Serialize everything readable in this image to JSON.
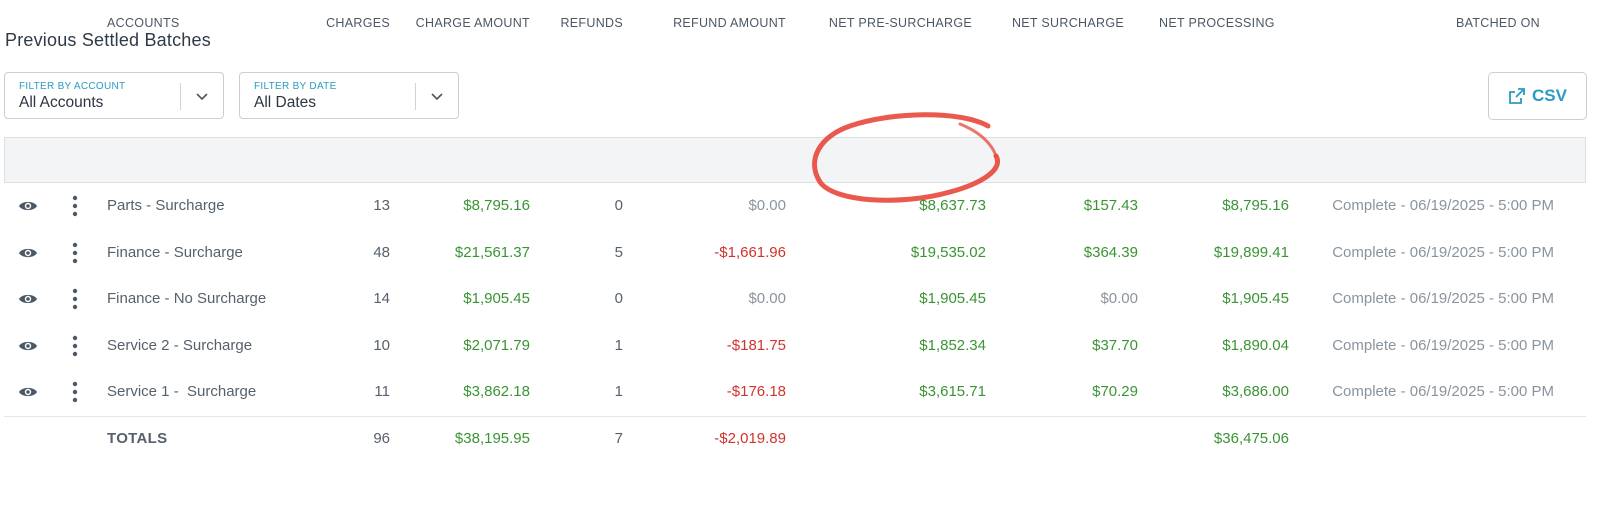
{
  "page": {
    "title": "Previous Settled Batches"
  },
  "filters": {
    "account": {
      "label": "FILTER BY ACCOUNT",
      "value": "All Accounts"
    },
    "date": {
      "label": "FILTER BY DATE",
      "value": "All Dates"
    }
  },
  "toolbar": {
    "csv_label": "CSV"
  },
  "table": {
    "headers": {
      "accounts": "ACCOUNTS",
      "charges": "CHARGES",
      "charge_amount": "CHARGE AMOUNT",
      "refunds": "REFUNDS",
      "refund_amount": "REFUND AMOUNT",
      "net_pre_surcharge": "NET PRE-SURCHARGE",
      "net_surcharge": "NET SURCHARGE",
      "net_processing": "NET PROCESSING",
      "batched_on": "BATCHED ON"
    },
    "rows": [
      {
        "account": "Parts - Surcharge",
        "charges": "13",
        "charge_amount": "$8,795.16",
        "refunds": "0",
        "refund_amount": "$0.00",
        "net_pre_surcharge": "$8,637.73",
        "net_surcharge": "$157.43",
        "net_processing": "$8,795.16",
        "batched_on": "Complete - 06/19/2025 - 5:00 PM"
      },
      {
        "account": "Finance - Surcharge",
        "charges": "48",
        "charge_amount": "$21,561.37",
        "refunds": "5",
        "refund_amount": "-$1,661.96",
        "net_pre_surcharge": "$19,535.02",
        "net_surcharge": "$364.39",
        "net_processing": "$19,899.41",
        "batched_on": "Complete - 06/19/2025 - 5:00 PM"
      },
      {
        "account": "Finance - No Surcharge",
        "charges": "14",
        "charge_amount": "$1,905.45",
        "refunds": "0",
        "refund_amount": "$0.00",
        "net_pre_surcharge": "$1,905.45",
        "net_surcharge": "$0.00",
        "net_processing": "$1,905.45",
        "batched_on": "Complete - 06/19/2025 - 5:00 PM"
      },
      {
        "account": "Service 2 - Surcharge",
        "charges": "10",
        "charge_amount": "$2,071.79",
        "refunds": "1",
        "refund_amount": "-$181.75",
        "net_pre_surcharge": "$1,852.34",
        "net_surcharge": "$37.70",
        "net_processing": "$1,890.04",
        "batched_on": "Complete - 06/19/2025 - 5:00 PM"
      },
      {
        "account": "Service 1 -  Surcharge",
        "charges": "11",
        "charge_amount": "$3,862.18",
        "refunds": "1",
        "refund_amount": "-$176.18",
        "net_pre_surcharge": "$3,615.71",
        "net_surcharge": "$70.29",
        "net_processing": "$3,686.00",
        "batched_on": "Complete - 06/19/2025 - 5:00 PM"
      }
    ],
    "totals": {
      "label": "TOTALS",
      "charges": "96",
      "charge_amount": "$38,195.95",
      "refunds": "7",
      "refund_amount": "-$2,019.89",
      "net_processing": "$36,475.06"
    }
  },
  "colors": {
    "accent": "#2a9bc2",
    "positive": "#3a9434",
    "negative": "#d0342c",
    "muted": "#8a949e",
    "annotation": "#e8473a"
  },
  "icons": {
    "row_view": "eye-icon",
    "row_menu": "more-vertical-icon",
    "csv": "external-link-icon",
    "dropdown": "chevron-down-icon"
  }
}
